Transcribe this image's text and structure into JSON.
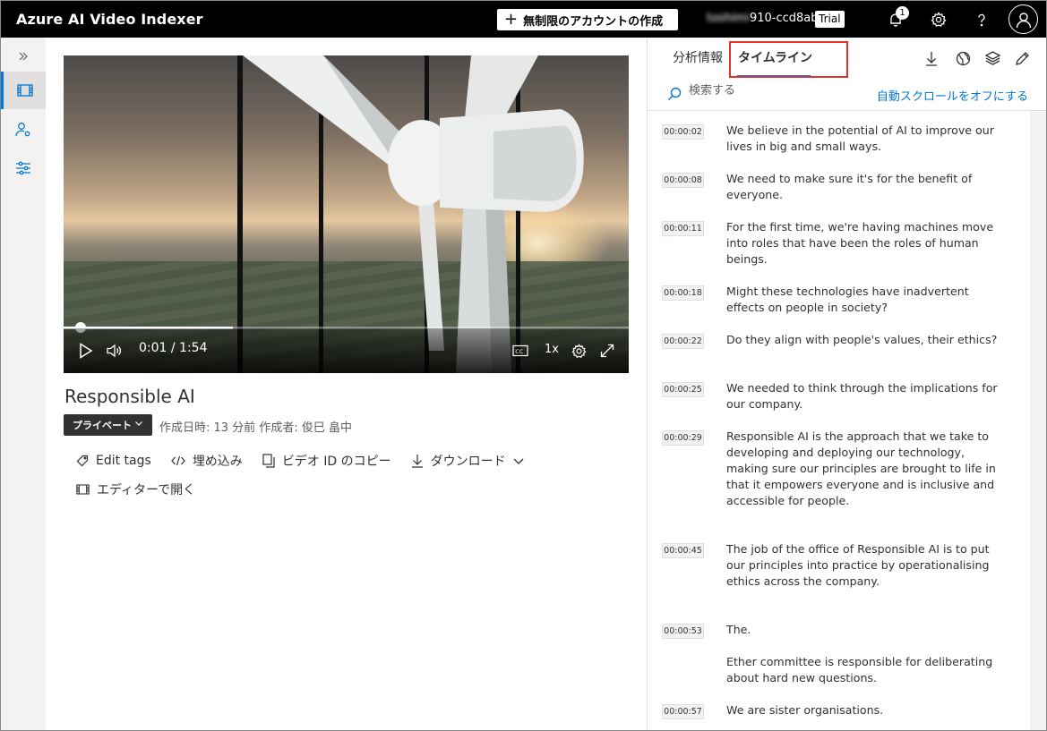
{
  "header": {
    "app_title": "Azure AI Video Indexer",
    "create_button": "無制限のアカウントの作成",
    "account_name_hidden": "toshimi",
    "account_name_visible": "910-ccd8ab",
    "trial_badge": "Trial",
    "notification_count": "1"
  },
  "video": {
    "current_time": "0:01 / 1:54",
    "speed": "1x",
    "progress_fraction": 0.009
  },
  "details": {
    "title": "Responsible AI",
    "privacy": "プライベート",
    "meta": "作成日時: 13 分前 作成者: 俊巳 畠中",
    "actions": {
      "edit_tags": "Edit tags",
      "embed": "埋め込み",
      "copy_id": "ビデオ ID のコピー",
      "download": "ダウンロード",
      "open_editor": "エディターで開く"
    }
  },
  "pane": {
    "tabs": {
      "insights": "分析情報",
      "timeline": "タイムライン"
    },
    "search_placeholder": "検索する",
    "autoscroll_link": "自動スクロールをオフにする"
  },
  "transcript": [
    {
      "time": "00:00:02",
      "text": "We believe in the potential of AI to improve our lives in big and small ways."
    },
    {
      "time": "00:00:08",
      "text": "We need to make sure it's for the benefit of everyone."
    },
    {
      "time": "00:00:11",
      "text": "For the first time, we're having machines move into roles that have been the roles of human beings."
    },
    {
      "time": "00:00:18",
      "text": "Might these technologies have inadvertent effects on people in society?"
    },
    {
      "time": "00:00:22",
      "text": "Do they align with people's values, their ethics?"
    },
    {
      "time": "00:00:25",
      "text": "We needed to think through the implications for our company."
    },
    {
      "time": "00:00:29",
      "text": "Responsible AI is the approach that we take to developing and deploying our technology, making sure our principles are brought to life in that it empowers everyone and is inclusive and accessible for people."
    },
    {
      "time": "00:00:45",
      "text": "The job of the office of Responsible AI is to put our principles into practice by operationalising ethics across the company."
    },
    {
      "time": "00:00:53",
      "text": "The."
    },
    {
      "time": "",
      "text": "Ether committee is responsible for deliberating about hard new questions."
    },
    {
      "time": "00:00:57",
      "text": "We are sister organisations."
    }
  ]
}
